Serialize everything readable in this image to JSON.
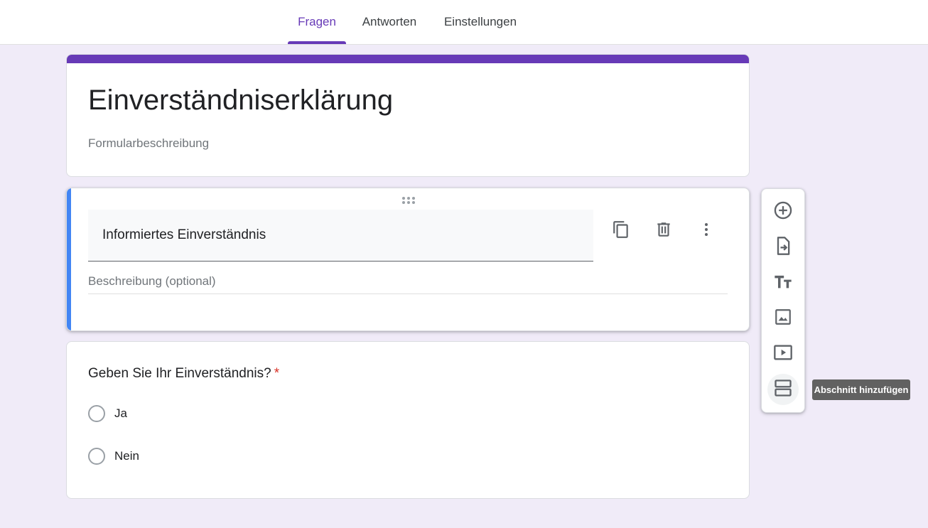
{
  "tabs": [
    {
      "label": "Fragen",
      "active": true
    },
    {
      "label": "Antworten",
      "active": false
    },
    {
      "label": "Einstellungen",
      "active": false
    }
  ],
  "header": {
    "title": "Einverständniserklärung",
    "description_placeholder": "Formularbeschreibung",
    "accent_color": "#673ab7"
  },
  "section": {
    "title": "Informiertes Einverständnis",
    "description_placeholder": "Beschreibung (optional)",
    "actions": [
      "duplicate-icon",
      "delete-icon",
      "more-vert-icon"
    ],
    "accent_color": "#4285f4"
  },
  "question": {
    "title": "Geben Sie Ihr Einverständnis?",
    "required_marker": "*",
    "options": [
      "Ja",
      "Nein"
    ]
  },
  "toolbar": {
    "tools": [
      "add-question-icon",
      "import-questions-icon",
      "add-title-icon",
      "add-image-icon",
      "add-video-icon",
      "add-section-icon"
    ],
    "tooltip": "Abschnitt hinzufügen"
  }
}
